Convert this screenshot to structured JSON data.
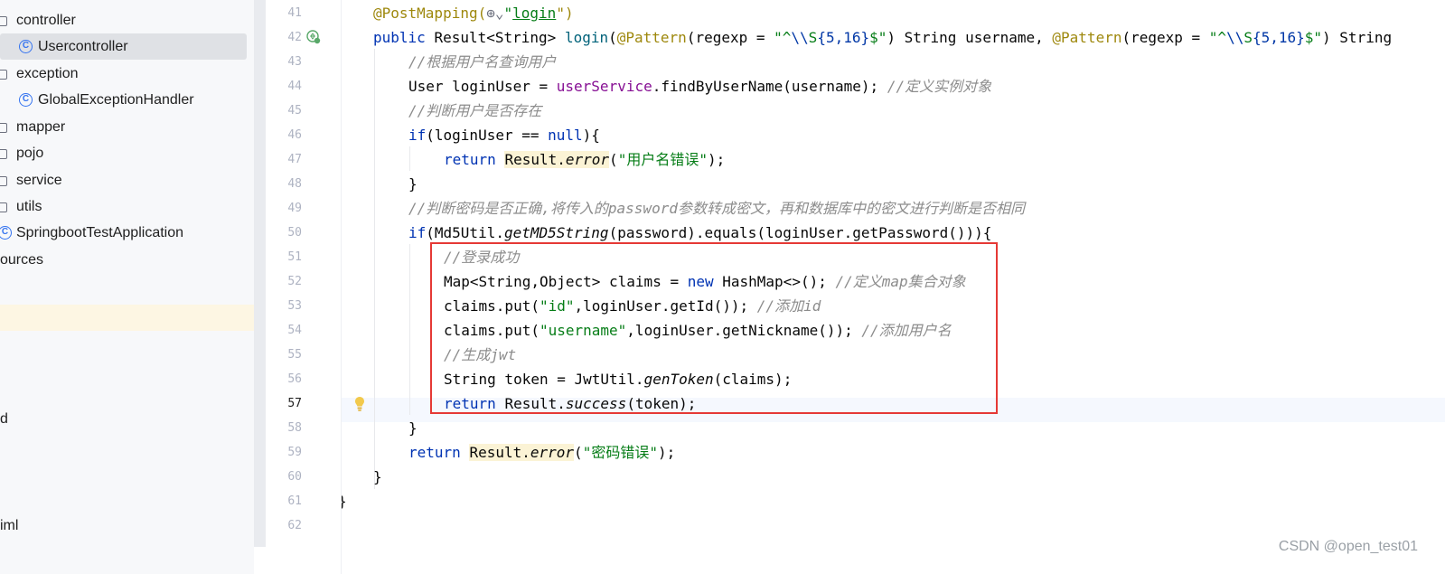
{
  "tree": {
    "items": [
      {
        "label": "controller",
        "icon": "folder-icon",
        "indent": 0
      },
      {
        "label": "Usercontroller",
        "icon": "class-icon",
        "indent": 1,
        "selected": true
      },
      {
        "label": "exception",
        "icon": "folder-icon",
        "indent": 0
      },
      {
        "label": "GlobalExceptionHandler",
        "icon": "class-icon",
        "indent": 1
      },
      {
        "label": "mapper",
        "icon": "folder-icon",
        "indent": 0
      },
      {
        "label": "pojo",
        "icon": "folder-icon",
        "indent": 0
      },
      {
        "label": "service",
        "icon": "folder-icon",
        "indent": 0
      },
      {
        "label": "utils",
        "icon": "folder-icon",
        "indent": 0
      },
      {
        "label": "SpringbootTestApplication",
        "icon": "spring-class-icon",
        "indent": 0
      },
      {
        "label": "ources",
        "icon": "",
        "indent": 0
      },
      {
        "label": "d",
        "icon": "",
        "indent": 0
      },
      {
        "label": "iml",
        "icon": "",
        "indent": 0
      }
    ]
  },
  "editor": {
    "current_line": "57",
    "lines": [
      {
        "no": "41"
      },
      {
        "no": "42"
      },
      {
        "no": "43"
      },
      {
        "no": "44"
      },
      {
        "no": "45"
      },
      {
        "no": "46"
      },
      {
        "no": "47"
      },
      {
        "no": "48"
      },
      {
        "no": "49"
      },
      {
        "no": "50"
      },
      {
        "no": "51"
      },
      {
        "no": "52"
      },
      {
        "no": "53"
      },
      {
        "no": "54"
      },
      {
        "no": "55"
      },
      {
        "no": "56"
      },
      {
        "no": "57"
      },
      {
        "no": "58"
      },
      {
        "no": "59"
      },
      {
        "no": "60"
      },
      {
        "no": "61"
      },
      {
        "no": "62"
      }
    ],
    "code": {
      "l41": [
        "@PostMapping(",
        "\"",
        "login",
        "\")"
      ],
      "l42": [
        "public ",
        "Result<String> ",
        "login",
        "(",
        "@Pattern",
        "(regexp = ",
        "\"^",
        "\\\\",
        "S",
        "{5,16}",
        "$\"",
        ") String username, ",
        "@Pattern",
        "(regexp = ",
        "\"^",
        "\\\\",
        "S",
        "{5,16}",
        "$\"",
        ") String"
      ],
      "l43": "//根据用户名查询用户",
      "l44": [
        "User loginUser = ",
        "userService",
        ".findByUserName(username); ",
        "//定义实例对象"
      ],
      "l45": "//判断用户是否存在",
      "l46": [
        "if",
        "(loginUser == ",
        "null",
        "){"
      ],
      "l47": [
        "return ",
        "Result.",
        "error",
        "(",
        "\"用户名错误\"",
        ");"
      ],
      "l48": "}",
      "l49": "//判断密码是否正确,将传入的password参数转成密文，再和数据库中的密文进行判断是否相同",
      "l50": [
        "if",
        "(Md5Util.",
        "getMD5String",
        "(password).equals(loginUser.getPassword())){"
      ],
      "l51": "//登录成功",
      "l52": [
        "Map<String,Object> claims = ",
        "new ",
        "HashMap<>(); ",
        "//定义map集合对象"
      ],
      "l53": [
        "claims.put(",
        "\"id\"",
        ",loginUser.getId()); ",
        "//添加id"
      ],
      "l54": [
        "claims.put(",
        "\"username\"",
        ",loginUser.getNickname()); ",
        "//添加用户名"
      ],
      "l55": "//生成jwt",
      "l56": [
        "String token = JwtUtil.",
        "genToken",
        "(claims);"
      ],
      "l57": [
        "return ",
        "Result.",
        "success",
        "(token);"
      ],
      "l58": "}",
      "l59": [
        "return ",
        "Result.",
        "error",
        "(",
        "\"密码错误\"",
        ");"
      ],
      "l60": "}",
      "l61": "}"
    }
  },
  "watermark": "CSDN @open_test01",
  "colors": {
    "keyword": "#0033b3",
    "string": "#067d17",
    "annotation": "#9e880d",
    "field": "#871094",
    "comment": "#8c8c8c",
    "highlight_box": "#e53935",
    "warning_bulb": "#f2c94c"
  }
}
